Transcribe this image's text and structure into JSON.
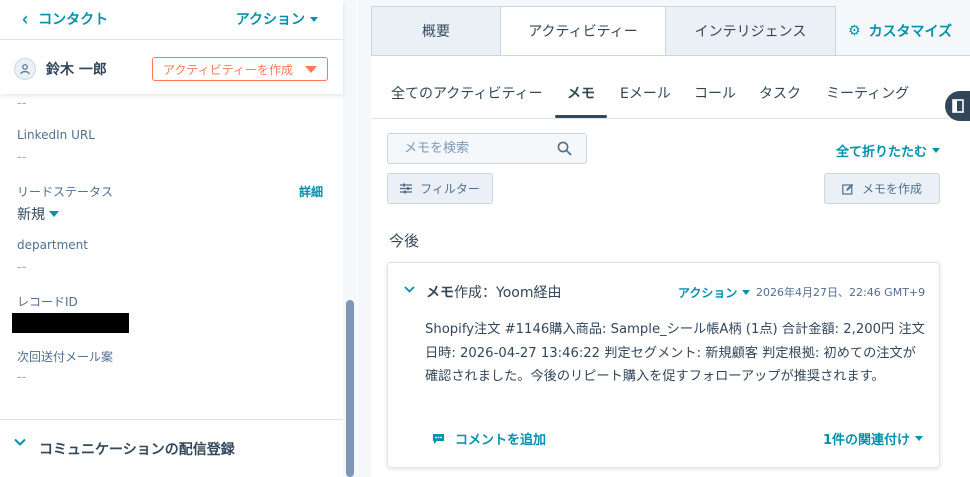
{
  "colors": {
    "link": "#0091ae",
    "accent_orange": "#ff7a59",
    "text": "#33475b",
    "muted": "#516f90"
  },
  "header": {
    "back_label": "コンタクト",
    "actions_label": "アクション"
  },
  "contact": {
    "name": "鈴木 一郎",
    "create_activity_label": "アクティビティーを作成",
    "avatar_icon": "person-icon"
  },
  "properties": {
    "top_value": "--",
    "linkedin": {
      "label": "LinkedIn URL",
      "value": "--"
    },
    "lead_status": {
      "label": "リードステータス",
      "value": "新規",
      "detail_label": "詳細"
    },
    "department": {
      "label": "department",
      "value": "--"
    },
    "record_id": {
      "label": "レコードID"
    },
    "next_mail": {
      "label": "次回送付メール案",
      "value": "--"
    }
  },
  "comm_section": {
    "title": "コミュニケーションの配信登録"
  },
  "top_tabs": [
    {
      "label": "概要",
      "active": false
    },
    {
      "label": "アクティビティー",
      "active": true
    },
    {
      "label": "インテリジェンス",
      "active": false
    }
  ],
  "customize_label": "カスタマイズ",
  "activity_tabs": [
    {
      "label": "全てのアクティビティー",
      "active": false
    },
    {
      "label": "メモ",
      "active": true
    },
    {
      "label": "Eメール",
      "active": false
    },
    {
      "label": "コール",
      "active": false
    },
    {
      "label": "タスク",
      "active": false
    },
    {
      "label": "ミーティング",
      "active": false
    }
  ],
  "search": {
    "placeholder": "メモを検索"
  },
  "collapse_all_label": "全て折りたたむ",
  "filter_label": "フィルター",
  "create_memo_label": "メモを作成",
  "group_heading": "今後",
  "memo": {
    "title_bold": "メモ",
    "title_rest": "作成：Yoom経由",
    "actions_label": "アクション",
    "timestamp": "2026年4月27日、22:46 GMT+9",
    "body": "Shopify注文 #1146購入商品: Sample_シール帳A柄 (1点) 合計金額: 2,200円 注文日時: 2026-04-27 13:46:22 判定セグメント: 新規顧客 判定根拠: 初めての注文が確認されました。今後のリピート購入を促すフォローアップが推奨されます。",
    "add_comment_label": "コメントを追加",
    "associations_label": "1件の関連付け"
  }
}
